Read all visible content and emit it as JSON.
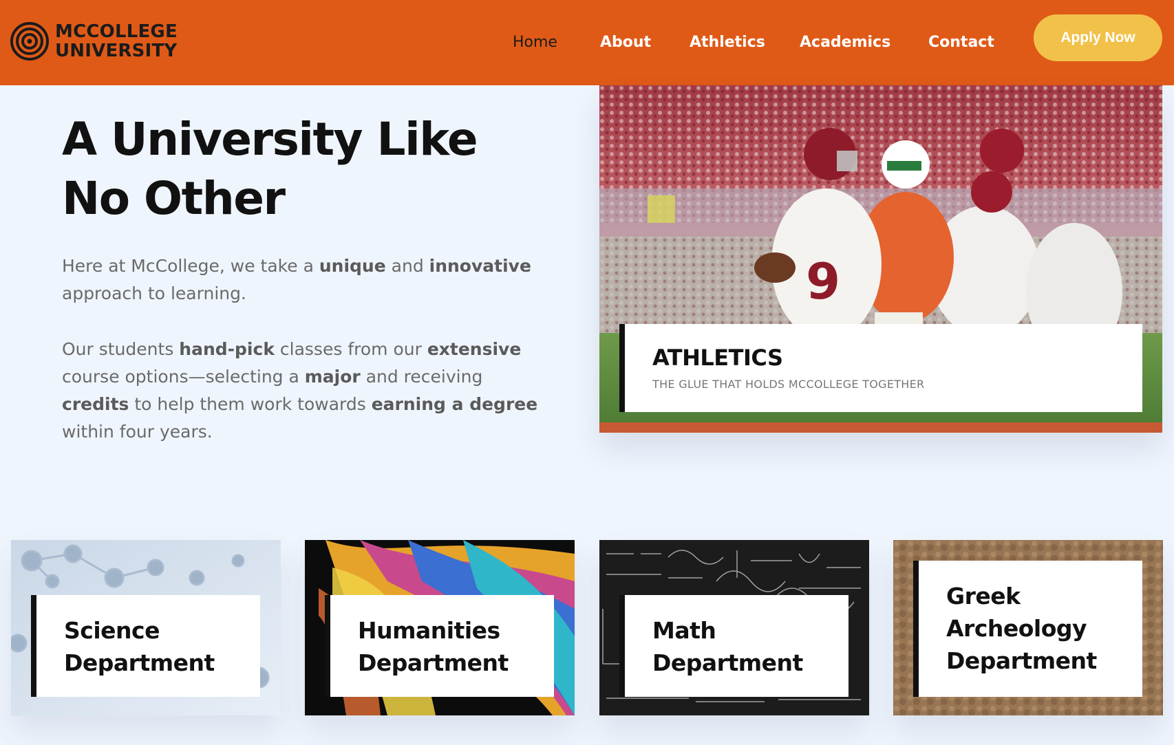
{
  "header": {
    "logo_line1": "MCCOLLEGE",
    "logo_line2": "UNIVERSITY",
    "logo_icon": "concentric-circles-logo",
    "nav": [
      "Home",
      "About",
      "Athletics",
      "Academics",
      "Contact"
    ],
    "active_nav": "Home",
    "apply_label": "Apply Now"
  },
  "hero": {
    "title": "A University Like No Other",
    "para1": {
      "t1": "Here at McCollege, we take a ",
      "b1": "unique",
      "t2": " and ",
      "b2": "innovative",
      "t3": " approach to learning."
    },
    "para2": {
      "t1": "Our students ",
      "b1": "hand-pick",
      "t2": " classes from our ",
      "b2": "extensive",
      "t3": " course options—selecting a ",
      "b3": "major",
      "t4": " and receiving ",
      "b4": "credits",
      "t5": " to help them work towards ",
      "b5": "earning a degree",
      "t6": " within four years."
    }
  },
  "athletics": {
    "title": "ATHLETICS",
    "subtitle": "THE GLUE THAT HOLDS MCCOLLEGE TOGETHER",
    "jersey_number": "9"
  },
  "departments": [
    {
      "line1": "Science",
      "line2": "Department",
      "line3": ""
    },
    {
      "line1": "Humanities",
      "line2": "Department",
      "line3": ""
    },
    {
      "line1": "Math",
      "line2": "Department",
      "line3": ""
    },
    {
      "line1": "Greek",
      "line2": "Archeology",
      "line3": "Department"
    }
  ],
  "colors": {
    "brand_orange": "#e05a17",
    "button_yellow": "#f2c14a",
    "page_background": "#eff5fd"
  }
}
